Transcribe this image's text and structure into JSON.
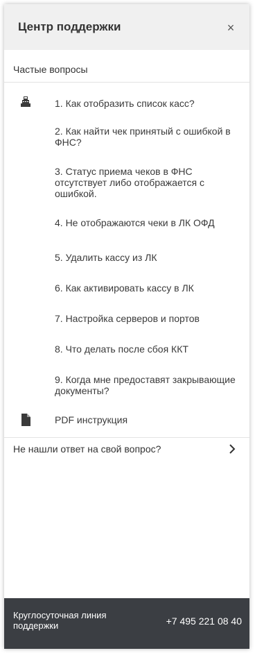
{
  "header": {
    "title": "Центр поддержки",
    "close_symbol": "×"
  },
  "faq": {
    "title": "Частые вопросы",
    "items": [
      "1. Как отобразить список касс?",
      "2. Как найти чек принятый с ошибкой в ФНС?",
      "3. Статус приема чеков в ФНС отсутствует либо отображается с ошибкой.",
      "4. Не отображаются чеки в ЛК ОФД",
      "5. Удалить кассу из ЛК",
      "6. Как активировать кассу в ЛК",
      "7. Настройка серверов и портов",
      "8. Что делать после сбоя ККТ",
      "9. Когда мне предоставят закрывающие документы?"
    ],
    "item_icon": "cash-register-icon"
  },
  "pdf": {
    "label": "PDF инструкция",
    "icon": "document-icon"
  },
  "not_found": {
    "label": "Не нашли ответ на свой вопрос?",
    "icon": "chevron-right-icon"
  },
  "footer": {
    "label": "Круглосуточная линия поддержки",
    "phone": "+7 495 221 08 40",
    "background": "#3b3e43"
  },
  "colors": {
    "header_bg": "#f0f0f0",
    "text": "#333333"
  }
}
